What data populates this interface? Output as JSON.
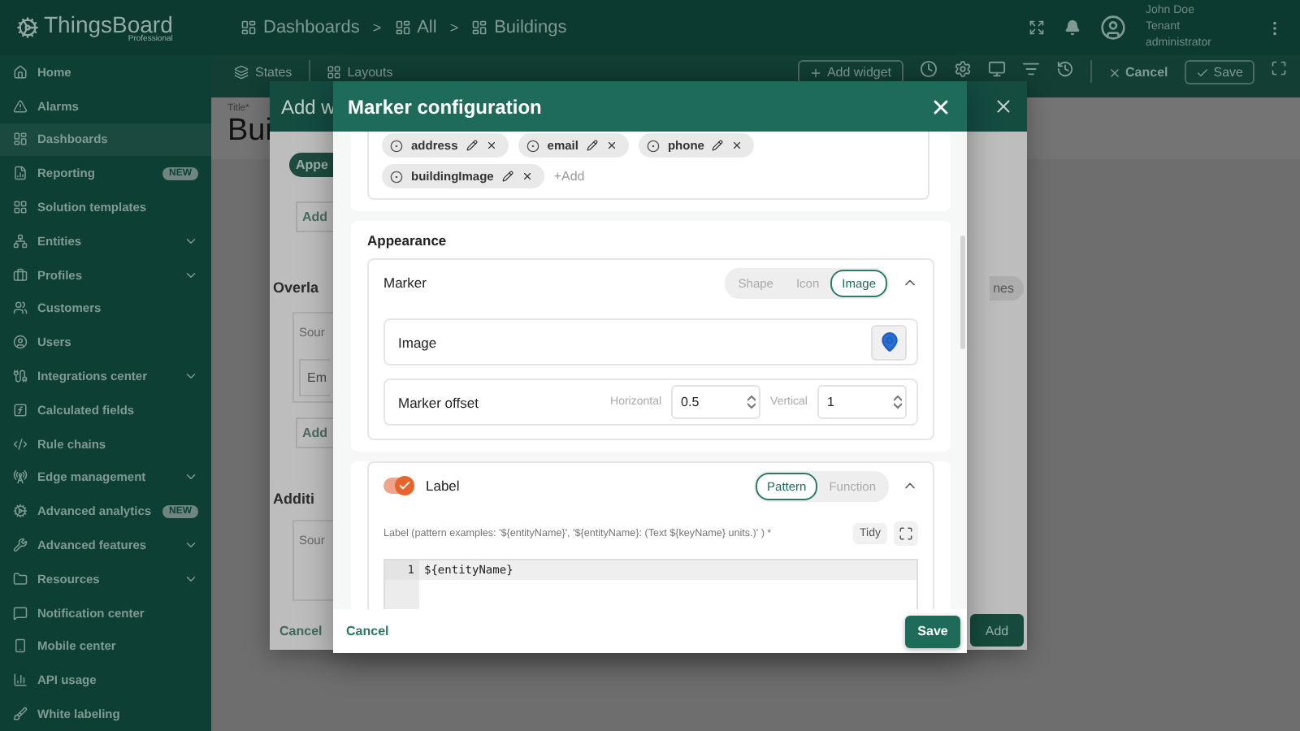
{
  "topbar": {
    "logo": "ThingsBoard",
    "logo_sub": "Professional",
    "breadcrumbs": [
      "Dashboards",
      "All",
      "Buildings"
    ],
    "separators": [
      ">",
      ">"
    ],
    "user_name": "John Doe",
    "user_role": "Tenant administrator"
  },
  "sidebar": {
    "items": [
      {
        "label": "Home",
        "selected": false,
        "expandable": false
      },
      {
        "label": "Alarms",
        "selected": false,
        "expandable": false
      },
      {
        "label": "Dashboards",
        "selected": true,
        "expandable": false
      },
      {
        "label": "Reporting",
        "selected": false,
        "expandable": false,
        "badge": "NEW"
      },
      {
        "label": "Solution templates",
        "selected": false,
        "expandable": false
      },
      {
        "label": "Entities",
        "selected": false,
        "expandable": true
      },
      {
        "label": "Profiles",
        "selected": false,
        "expandable": true
      },
      {
        "label": "Customers",
        "selected": false,
        "expandable": false
      },
      {
        "label": "Users",
        "selected": false,
        "expandable": false
      },
      {
        "label": "Integrations center",
        "selected": false,
        "expandable": true
      },
      {
        "label": "Calculated fields",
        "selected": false,
        "expandable": false
      },
      {
        "label": "Rule chains",
        "selected": false,
        "expandable": false
      },
      {
        "label": "Edge management",
        "selected": false,
        "expandable": true
      },
      {
        "label": "Advanced analytics",
        "selected": false,
        "expandable": false,
        "badge": "NEW"
      },
      {
        "label": "Advanced features",
        "selected": false,
        "expandable": true
      },
      {
        "label": "Resources",
        "selected": false,
        "expandable": true
      },
      {
        "label": "Notification center",
        "selected": false,
        "expandable": false
      },
      {
        "label": "Mobile center",
        "selected": false,
        "expandable": false
      },
      {
        "label": "API usage",
        "selected": false,
        "expandable": false
      },
      {
        "label": "White labeling",
        "selected": false,
        "expandable": false
      }
    ]
  },
  "toolbar": {
    "tabs": [
      "States",
      "Layouts"
    ],
    "add_widget": "Add widget",
    "cancel": "Cancel",
    "save": "Save"
  },
  "page": {
    "title_label": "Title*",
    "title": "Bui"
  },
  "widget_dialog": {
    "title": "Add w",
    "tab": "Appe",
    "add_1": "Add",
    "section_1": "Overla",
    "source_1": "Sour",
    "field_1": "Em",
    "add_2": "Add",
    "section_2": "Additi",
    "source_2": "Sour",
    "cancel": "Cancel",
    "right_chip": "nes",
    "add": "Add"
  },
  "marker_dialog": {
    "title": "Marker configuration",
    "chips": [
      {
        "label": "address"
      },
      {
        "label": "email"
      },
      {
        "label": "phone"
      },
      {
        "label": "buildingImage"
      }
    ],
    "add_link": "+Add",
    "appearance_title": "Appearance",
    "marker": {
      "title": "Marker",
      "types": [
        {
          "label": "Shape",
          "selected": false
        },
        {
          "label": "Icon",
          "selected": false
        },
        {
          "label": "Image",
          "selected": true
        }
      ],
      "image_label": "Image",
      "offset_label": "Marker offset",
      "horizontal_label": "Horizontal",
      "horizontal_value": "0.5",
      "vertical_label": "Vertical",
      "vertical_value": "1"
    },
    "label": {
      "enabled": true,
      "title": "Label",
      "modes": [
        {
          "label": "Pattern",
          "selected": true
        },
        {
          "label": "Function",
          "selected": false
        }
      ],
      "hint": "Label (pattern examples: '${entityName}', '${entityName}: (Text ${keyName} units.)' ) *",
      "tidy": "Tidy",
      "lines": [
        {
          "number": "1",
          "text": "${entityName}"
        }
      ]
    },
    "cancel": "Cancel",
    "save": "Save"
  }
}
